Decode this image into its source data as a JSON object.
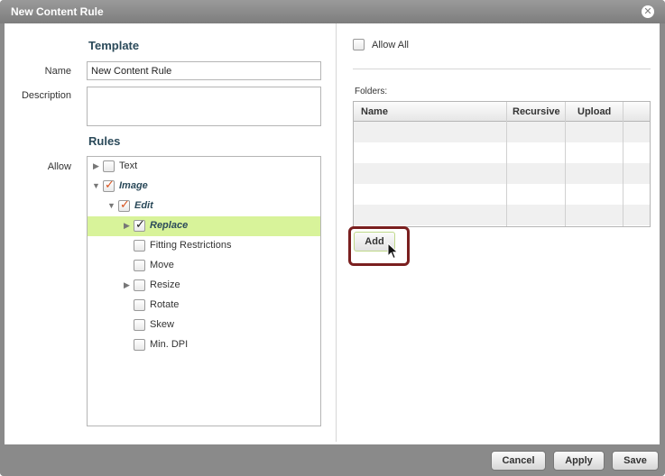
{
  "window": {
    "title": "New Content Rule"
  },
  "template": {
    "heading": "Template",
    "name_label": "Name",
    "name_value": "New Content Rule",
    "description_label": "Description",
    "description_value": ""
  },
  "rules": {
    "heading": "Rules",
    "allow_label": "Allow",
    "tree": [
      {
        "label": "Text",
        "checked": false,
        "expandable": true,
        "expanded": false
      },
      {
        "label": "Image",
        "checked": true,
        "expandable": true,
        "expanded": true
      },
      {
        "label": "Edit",
        "checked": true,
        "expandable": true,
        "expanded": true
      },
      {
        "label": "Replace",
        "checked": true,
        "expandable": true,
        "expanded": false,
        "selected": true
      },
      {
        "label": "Fitting Restrictions",
        "checked": false
      },
      {
        "label": "Move",
        "checked": false
      },
      {
        "label": "Resize",
        "checked": false,
        "expandable": true,
        "expanded": false
      },
      {
        "label": "Rotate",
        "checked": false
      },
      {
        "label": "Skew",
        "checked": false
      },
      {
        "label": "Min. DPI",
        "checked": false
      }
    ]
  },
  "folders": {
    "allow_all_label": "Allow All",
    "allow_all_checked": false,
    "label": "Folders:",
    "columns": [
      "Name",
      "Recursive",
      "Upload"
    ],
    "rows": [],
    "add_label": "Add"
  },
  "footer": {
    "cancel_label": "Cancel",
    "apply_label": "Apply",
    "save_label": "Save"
  },
  "colors": {
    "selected_row": "#d8f39a",
    "check_red": "#d9531e",
    "highlight_ring": "#7a1f1f"
  }
}
